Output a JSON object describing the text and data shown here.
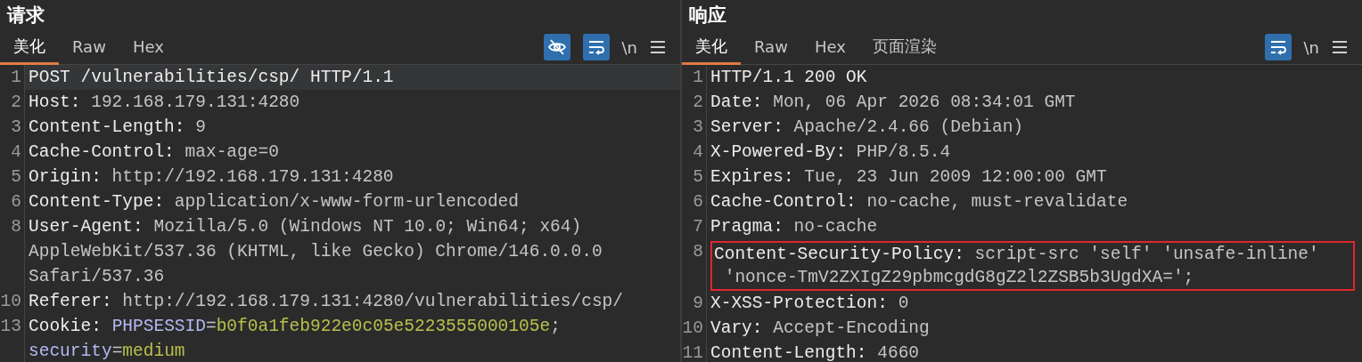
{
  "panels": [
    {
      "title": "请求",
      "tabs": [
        {
          "label": "美化",
          "selected": true
        },
        {
          "label": "Raw",
          "selected": false
        },
        {
          "label": "Hex",
          "selected": false
        }
      ],
      "tools": [
        {
          "kind": "hide",
          "on": true
        },
        {
          "kind": "wrap",
          "on": true
        },
        {
          "kind": "newline",
          "label": "\\n"
        },
        {
          "kind": "menu"
        }
      ],
      "lines": [
        {
          "number": "1",
          "current": true,
          "highlighted": false,
          "rows": [
            {
              "parts": [
                {
                  "kind": "key",
                  "text": "POST /vulnerabilities/csp/ HTTP/1.1"
                }
              ]
            }
          ]
        },
        {
          "number": "2",
          "current": false,
          "highlighted": false,
          "rows": [
            {
              "parts": [
                {
                  "kind": "key",
                  "text": "Host:"
                },
                {
                  "kind": "value",
                  "text": " 192.168.179.131:4280"
                }
              ]
            }
          ]
        },
        {
          "number": "3",
          "current": false,
          "highlighted": false,
          "rows": [
            {
              "parts": [
                {
                  "kind": "key",
                  "text": "Content-Length:"
                },
                {
                  "kind": "value",
                  "text": " 9"
                }
              ]
            }
          ]
        },
        {
          "number": "4",
          "current": false,
          "highlighted": false,
          "rows": [
            {
              "parts": [
                {
                  "kind": "key",
                  "text": "Cache-Control:"
                },
                {
                  "kind": "value",
                  "text": " max-age=0"
                }
              ]
            }
          ]
        },
        {
          "number": "5",
          "current": false,
          "highlighted": false,
          "rows": [
            {
              "parts": [
                {
                  "kind": "key",
                  "text": "Origin:"
                },
                {
                  "kind": "value",
                  "text": " http://192.168.179.131:4280"
                }
              ]
            }
          ]
        },
        {
          "number": "6",
          "current": false,
          "highlighted": false,
          "rows": [
            {
              "parts": [
                {
                  "kind": "key",
                  "text": "Content-Type:"
                },
                {
                  "kind": "value",
                  "text": " application/x-www-form-urlencoded"
                }
              ]
            }
          ]
        },
        {
          "number": "8",
          "current": false,
          "highlighted": false,
          "rows": [
            {
              "parts": [
                {
                  "kind": "key",
                  "text": "User-Agent:"
                },
                {
                  "kind": "value",
                  "text": " Mozilla/5.0 (Windows NT 10.0; Win64; x64)"
                }
              ]
            },
            {
              "parts": [
                {
                  "kind": "value",
                  "text": "AppleWebKit/537.36 (KHTML, like Gecko) Chrome/146.0.0.0"
                }
              ]
            },
            {
              "parts": [
                {
                  "kind": "value",
                  "text": "Safari/537.36"
                }
              ]
            }
          ]
        },
        {
          "number": "10",
          "current": false,
          "highlighted": false,
          "rows": [
            {
              "parts": [
                {
                  "kind": "key",
                  "text": "Referer:"
                },
                {
                  "kind": "value",
                  "text": " http://192.168.179.131:4280/vulnerabilities/csp/"
                }
              ]
            }
          ]
        },
        {
          "number": "13",
          "current": false,
          "highlighted": false,
          "rows": [
            {
              "parts": [
                {
                  "kind": "key",
                  "text": "Cookie: "
                },
                {
                  "kind": "cookie-name",
                  "text": "PHPSESSID"
                },
                {
                  "kind": "value",
                  "text": "="
                },
                {
                  "kind": "cookie-value",
                  "text": "b0f0a1feb922e0c05e5223555000105e"
                },
                {
                  "kind": "value",
                  "text": ";"
                }
              ]
            },
            {
              "parts": [
                {
                  "kind": "cookie-name",
                  "text": "security"
                },
                {
                  "kind": "value",
                  "text": "="
                },
                {
                  "kind": "cookie-value",
                  "text": "medium"
                }
              ]
            }
          ]
        }
      ]
    },
    {
      "title": "响应",
      "tabs": [
        {
          "label": "美化",
          "selected": true
        },
        {
          "label": "Raw",
          "selected": false
        },
        {
          "label": "Hex",
          "selected": false
        },
        {
          "label": "页面渲染",
          "selected": false
        }
      ],
      "tools": [
        {
          "kind": "wrap",
          "on": true
        },
        {
          "kind": "newline",
          "label": "\\n"
        },
        {
          "kind": "menu"
        }
      ],
      "lines": [
        {
          "number": "1",
          "current": false,
          "highlighted": false,
          "rows": [
            {
              "parts": [
                {
                  "kind": "key",
                  "text": "HTTP/1.1 200 OK"
                }
              ]
            }
          ]
        },
        {
          "number": "2",
          "current": false,
          "highlighted": false,
          "rows": [
            {
              "parts": [
                {
                  "kind": "key",
                  "text": "Date:"
                },
                {
                  "kind": "value",
                  "text": " Mon, 06 Apr 2026 08:34:01 GMT"
                }
              ]
            }
          ]
        },
        {
          "number": "3",
          "current": false,
          "highlighted": false,
          "rows": [
            {
              "parts": [
                {
                  "kind": "key",
                  "text": "Server:"
                },
                {
                  "kind": "value",
                  "text": " Apache/2.4.66 (Debian)"
                }
              ]
            }
          ]
        },
        {
          "number": "4",
          "current": false,
          "highlighted": false,
          "rows": [
            {
              "parts": [
                {
                  "kind": "key",
                  "text": "X-Powered-By:"
                },
                {
                  "kind": "value",
                  "text": " PHP/8.5.4"
                }
              ]
            }
          ]
        },
        {
          "number": "5",
          "current": false,
          "highlighted": false,
          "rows": [
            {
              "parts": [
                {
                  "kind": "key",
                  "text": "Expires:"
                },
                {
                  "kind": "value",
                  "text": " Tue, 23 Jun 2009 12:00:00 GMT"
                }
              ]
            }
          ]
        },
        {
          "number": "6",
          "current": false,
          "highlighted": false,
          "rows": [
            {
              "parts": [
                {
                  "kind": "key",
                  "text": "Cache-Control:"
                },
                {
                  "kind": "value",
                  "text": " no-cache, must-revalidate"
                }
              ]
            }
          ]
        },
        {
          "number": "7",
          "current": false,
          "highlighted": false,
          "rows": [
            {
              "parts": [
                {
                  "kind": "key",
                  "text": "Pragma:"
                },
                {
                  "kind": "value",
                  "text": " no-cache"
                }
              ]
            }
          ]
        },
        {
          "number": "8",
          "current": false,
          "highlighted": true,
          "rows": [
            {
              "parts": [
                {
                  "kind": "key",
                  "text": "Content-Security-Policy:"
                },
                {
                  "kind": "value",
                  "text": " script-src 'self' 'unsafe-inline'"
                }
              ]
            },
            {
              "parts": [
                {
                  "kind": "value",
                  "text": " 'nonce-TmV2ZXIgZ29pbmcgdG8gZ2l2ZSB5b3UgdXA=';"
                }
              ]
            }
          ]
        },
        {
          "number": "9",
          "current": false,
          "highlighted": false,
          "rows": [
            {
              "parts": [
                {
                  "kind": "key",
                  "text": "X-XSS-Protection:"
                },
                {
                  "kind": "value",
                  "text": " 0"
                }
              ]
            }
          ]
        },
        {
          "number": "10",
          "current": false,
          "highlighted": false,
          "rows": [
            {
              "parts": [
                {
                  "kind": "key",
                  "text": "Vary:"
                },
                {
                  "kind": "value",
                  "text": " Accept-Encoding"
                }
              ]
            }
          ]
        },
        {
          "number": "11",
          "current": false,
          "highlighted": false,
          "rows": [
            {
              "parts": [
                {
                  "kind": "key",
                  "text": "Content-Length:"
                },
                {
                  "kind": "value",
                  "text": " 4660"
                }
              ]
            }
          ]
        }
      ]
    }
  ]
}
